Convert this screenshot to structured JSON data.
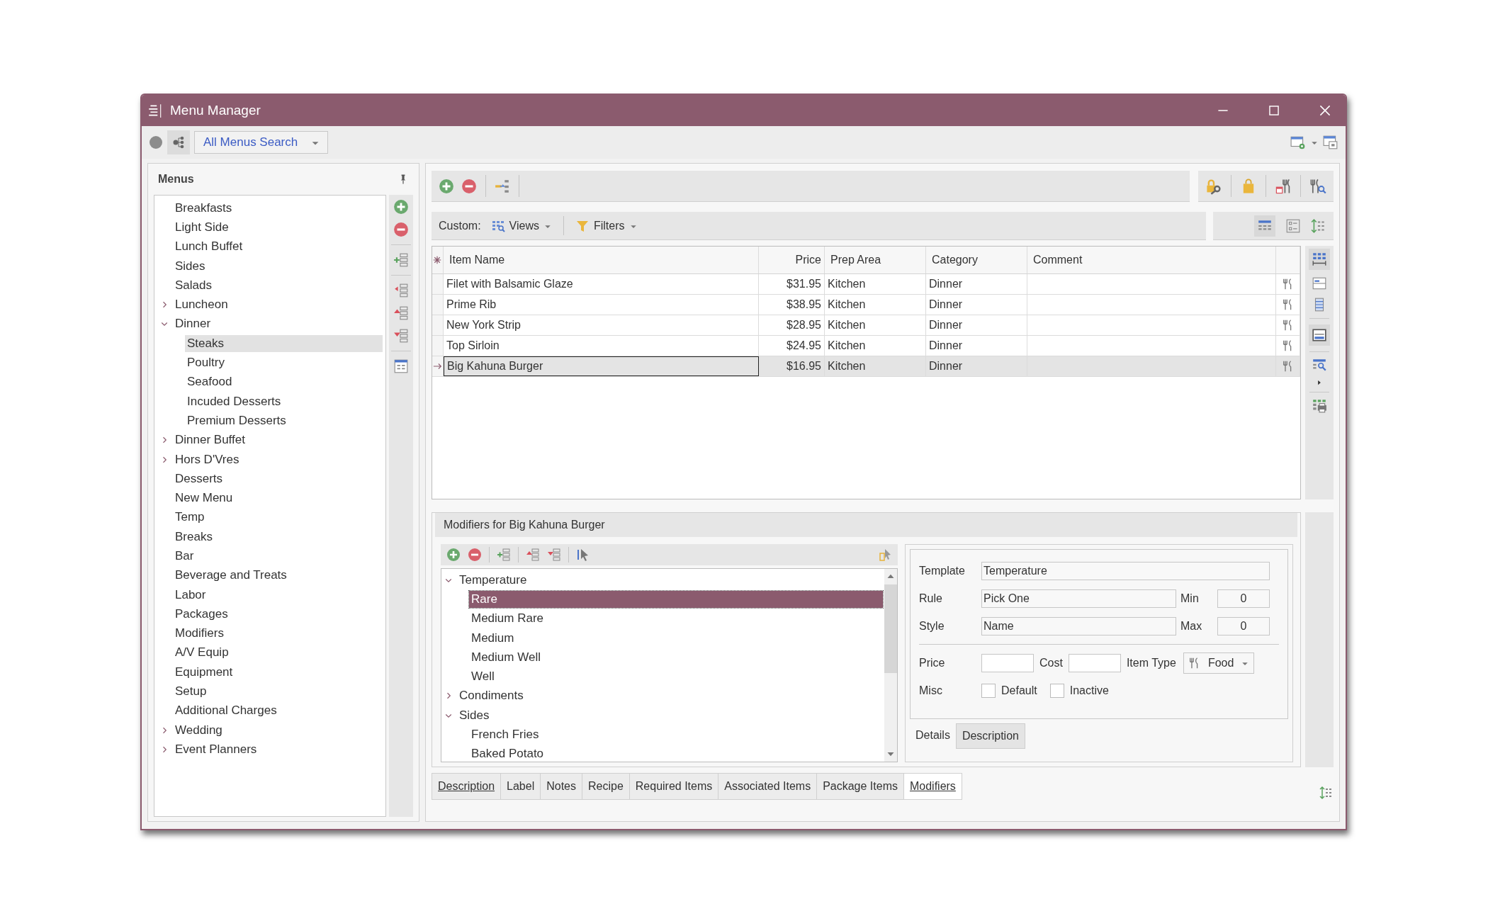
{
  "window": {
    "title": "Menu Manager"
  },
  "top_bar": {
    "search_dropdown": "All Menus Search"
  },
  "menus_panel": {
    "title": "Menus",
    "items": [
      {
        "label": "Breakfasts",
        "selected": false
      },
      {
        "label": "Light Side",
        "selected": false
      },
      {
        "label": "Lunch Buffet",
        "selected": false
      },
      {
        "label": "Sides",
        "selected": false
      },
      {
        "label": "Salads",
        "selected": false
      },
      {
        "label": "Luncheon",
        "selected": false,
        "expanded": false
      },
      {
        "label": "Dinner",
        "selected": false,
        "expanded": true,
        "children": [
          {
            "label": "Steaks",
            "selected": true
          },
          {
            "label": "Poultry",
            "selected": false
          },
          {
            "label": "Seafood",
            "selected": false
          },
          {
            "label": "Incuded Desserts",
            "selected": false
          },
          {
            "label": "Premium Desserts",
            "selected": false
          }
        ]
      },
      {
        "label": "Dinner Buffet",
        "selected": false,
        "expanded": false
      },
      {
        "label": "Hors D'Vres",
        "selected": false,
        "expanded": false
      },
      {
        "label": "Desserts",
        "selected": false
      },
      {
        "label": "New Menu",
        "selected": false
      },
      {
        "label": "Temp",
        "selected": false
      },
      {
        "label": "Breaks",
        "selected": false
      },
      {
        "label": "Bar",
        "selected": false
      },
      {
        "label": "Beverage and Treats",
        "selected": false
      },
      {
        "label": "Labor",
        "selected": false
      },
      {
        "label": "Packages",
        "selected": false
      },
      {
        "label": "Modifiers",
        "selected": false
      },
      {
        "label": "A/V Equip",
        "selected": false
      },
      {
        "label": "Equipment",
        "selected": false
      },
      {
        "label": "Setup",
        "selected": false
      },
      {
        "label": "Additional Charges",
        "selected": false
      },
      {
        "label": "Wedding",
        "selected": false,
        "expanded": false
      },
      {
        "label": "Event Planners",
        "selected": false,
        "expanded": false
      }
    ]
  },
  "items_toolbar": {
    "custom_label": "Custom:",
    "views_button": "Views",
    "filters_button": "Filters"
  },
  "items_grid": {
    "columns": [
      "Item Name",
      "Price",
      "Prep Area",
      "Category",
      "Comment"
    ],
    "rows": [
      {
        "item_name": "Filet with Balsamic Glaze",
        "price": "$31.95",
        "prep_area": "Kitchen",
        "category": "Dinner",
        "selected": false
      },
      {
        "item_name": "Prime Rib",
        "price": "$38.95",
        "prep_area": "Kitchen",
        "category": "Dinner",
        "selected": false
      },
      {
        "item_name": "New York Strip",
        "price": "$28.95",
        "prep_area": "Kitchen",
        "category": "Dinner",
        "selected": false
      },
      {
        "item_name": "Top Sirloin",
        "price": "$24.95",
        "prep_area": "Kitchen",
        "category": "Dinner",
        "selected": false
      },
      {
        "item_name": "Big Kahuna Burger",
        "price": "$16.95",
        "prep_area": "Kitchen",
        "category": "Dinner",
        "selected": true
      }
    ]
  },
  "modifiers_panel": {
    "title": "Modifiers for Big Kahuna Burger",
    "tree": [
      {
        "label": "Temperature",
        "selected": false,
        "expanded": true,
        "children": [
          {
            "label": "Rare",
            "selected": true
          },
          {
            "label": "Medium Rare",
            "selected": false
          },
          {
            "label": "Medium",
            "selected": false
          },
          {
            "label": "Medium Well",
            "selected": false
          },
          {
            "label": "Well",
            "selected": false
          }
        ]
      },
      {
        "label": "Condiments",
        "selected": false,
        "expanded": false
      },
      {
        "label": "Sides",
        "selected": false,
        "expanded": true,
        "children": [
          {
            "label": "French Fries",
            "selected": false
          },
          {
            "label": "Baked Potato",
            "selected": false
          }
        ]
      }
    ],
    "details": {
      "template_label": "Template",
      "template": "Temperature",
      "rule_label": "Rule",
      "rule": "Pick One",
      "min_label": "Min",
      "min": "0",
      "style_label": "Style",
      "style": "Name",
      "max_label": "Max",
      "max": "0",
      "price_label": "Price",
      "cost_label": "Cost",
      "item_type_label": "Item Type",
      "item_type": "Food",
      "misc_label": "Misc",
      "checkboxes": [
        {
          "label": "Default",
          "checked": false
        },
        {
          "label": "Inactive",
          "checked": false
        }
      ]
    },
    "detail_tabs": [
      {
        "label": "Details",
        "selected": true
      },
      {
        "label": "Description",
        "selected": false
      }
    ]
  },
  "bottom_tabs": [
    {
      "label": "Description",
      "underlined": true,
      "selected": false
    },
    {
      "label": "Label",
      "underlined": false,
      "selected": false
    },
    {
      "label": "Notes",
      "underlined": false,
      "selected": false
    },
    {
      "label": "Recipe",
      "underlined": false,
      "selected": false
    },
    {
      "label": "Required Items",
      "underlined": false,
      "selected": false
    },
    {
      "label": "Associated Items",
      "underlined": false,
      "selected": false
    },
    {
      "label": "Package Items",
      "underlined": false,
      "selected": false
    },
    {
      "label": "Modifiers",
      "underlined": true,
      "selected": true
    }
  ]
}
